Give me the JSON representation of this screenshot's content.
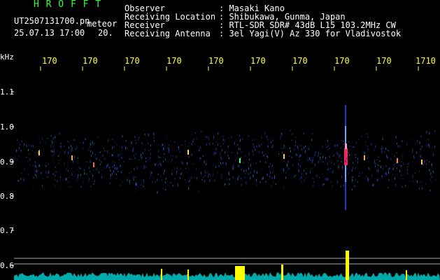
{
  "header": {
    "program": "H R O F F T",
    "filename": "UT2507131700.pn",
    "mode": "meteor",
    "datetime": "25.07.13 17:00",
    "number": "20.",
    "info": [
      {
        "label": "Observer",
        "value": ": Masaki Kano"
      },
      {
        "label": "Receiving Location",
        "value": ": Shibukawa, Gunma, Japan"
      },
      {
        "label": "Receiver",
        "value": ": RTL-SDR SDR# 43dB L15 103.2MHz CW"
      },
      {
        "label": "Receiving Antenna",
        "value": ": 3el Yagi(V) Az 330 for Vladivostok"
      }
    ]
  },
  "axes": {
    "unit": "kHz",
    "x_ticks": [
      "170",
      "170",
      "170",
      "170",
      "170",
      "170",
      "170",
      "170",
      "170",
      "1710"
    ],
    "y_ticks": [
      "1.1",
      "1.0",
      "0.9",
      "0.8",
      "0.7",
      "0.6"
    ]
  },
  "colors": {
    "text": "#ffffff",
    "program": "#33ff33",
    "ticks": "#ffff33",
    "spectrum": "#00cccc",
    "signal": "#ffff00"
  }
}
